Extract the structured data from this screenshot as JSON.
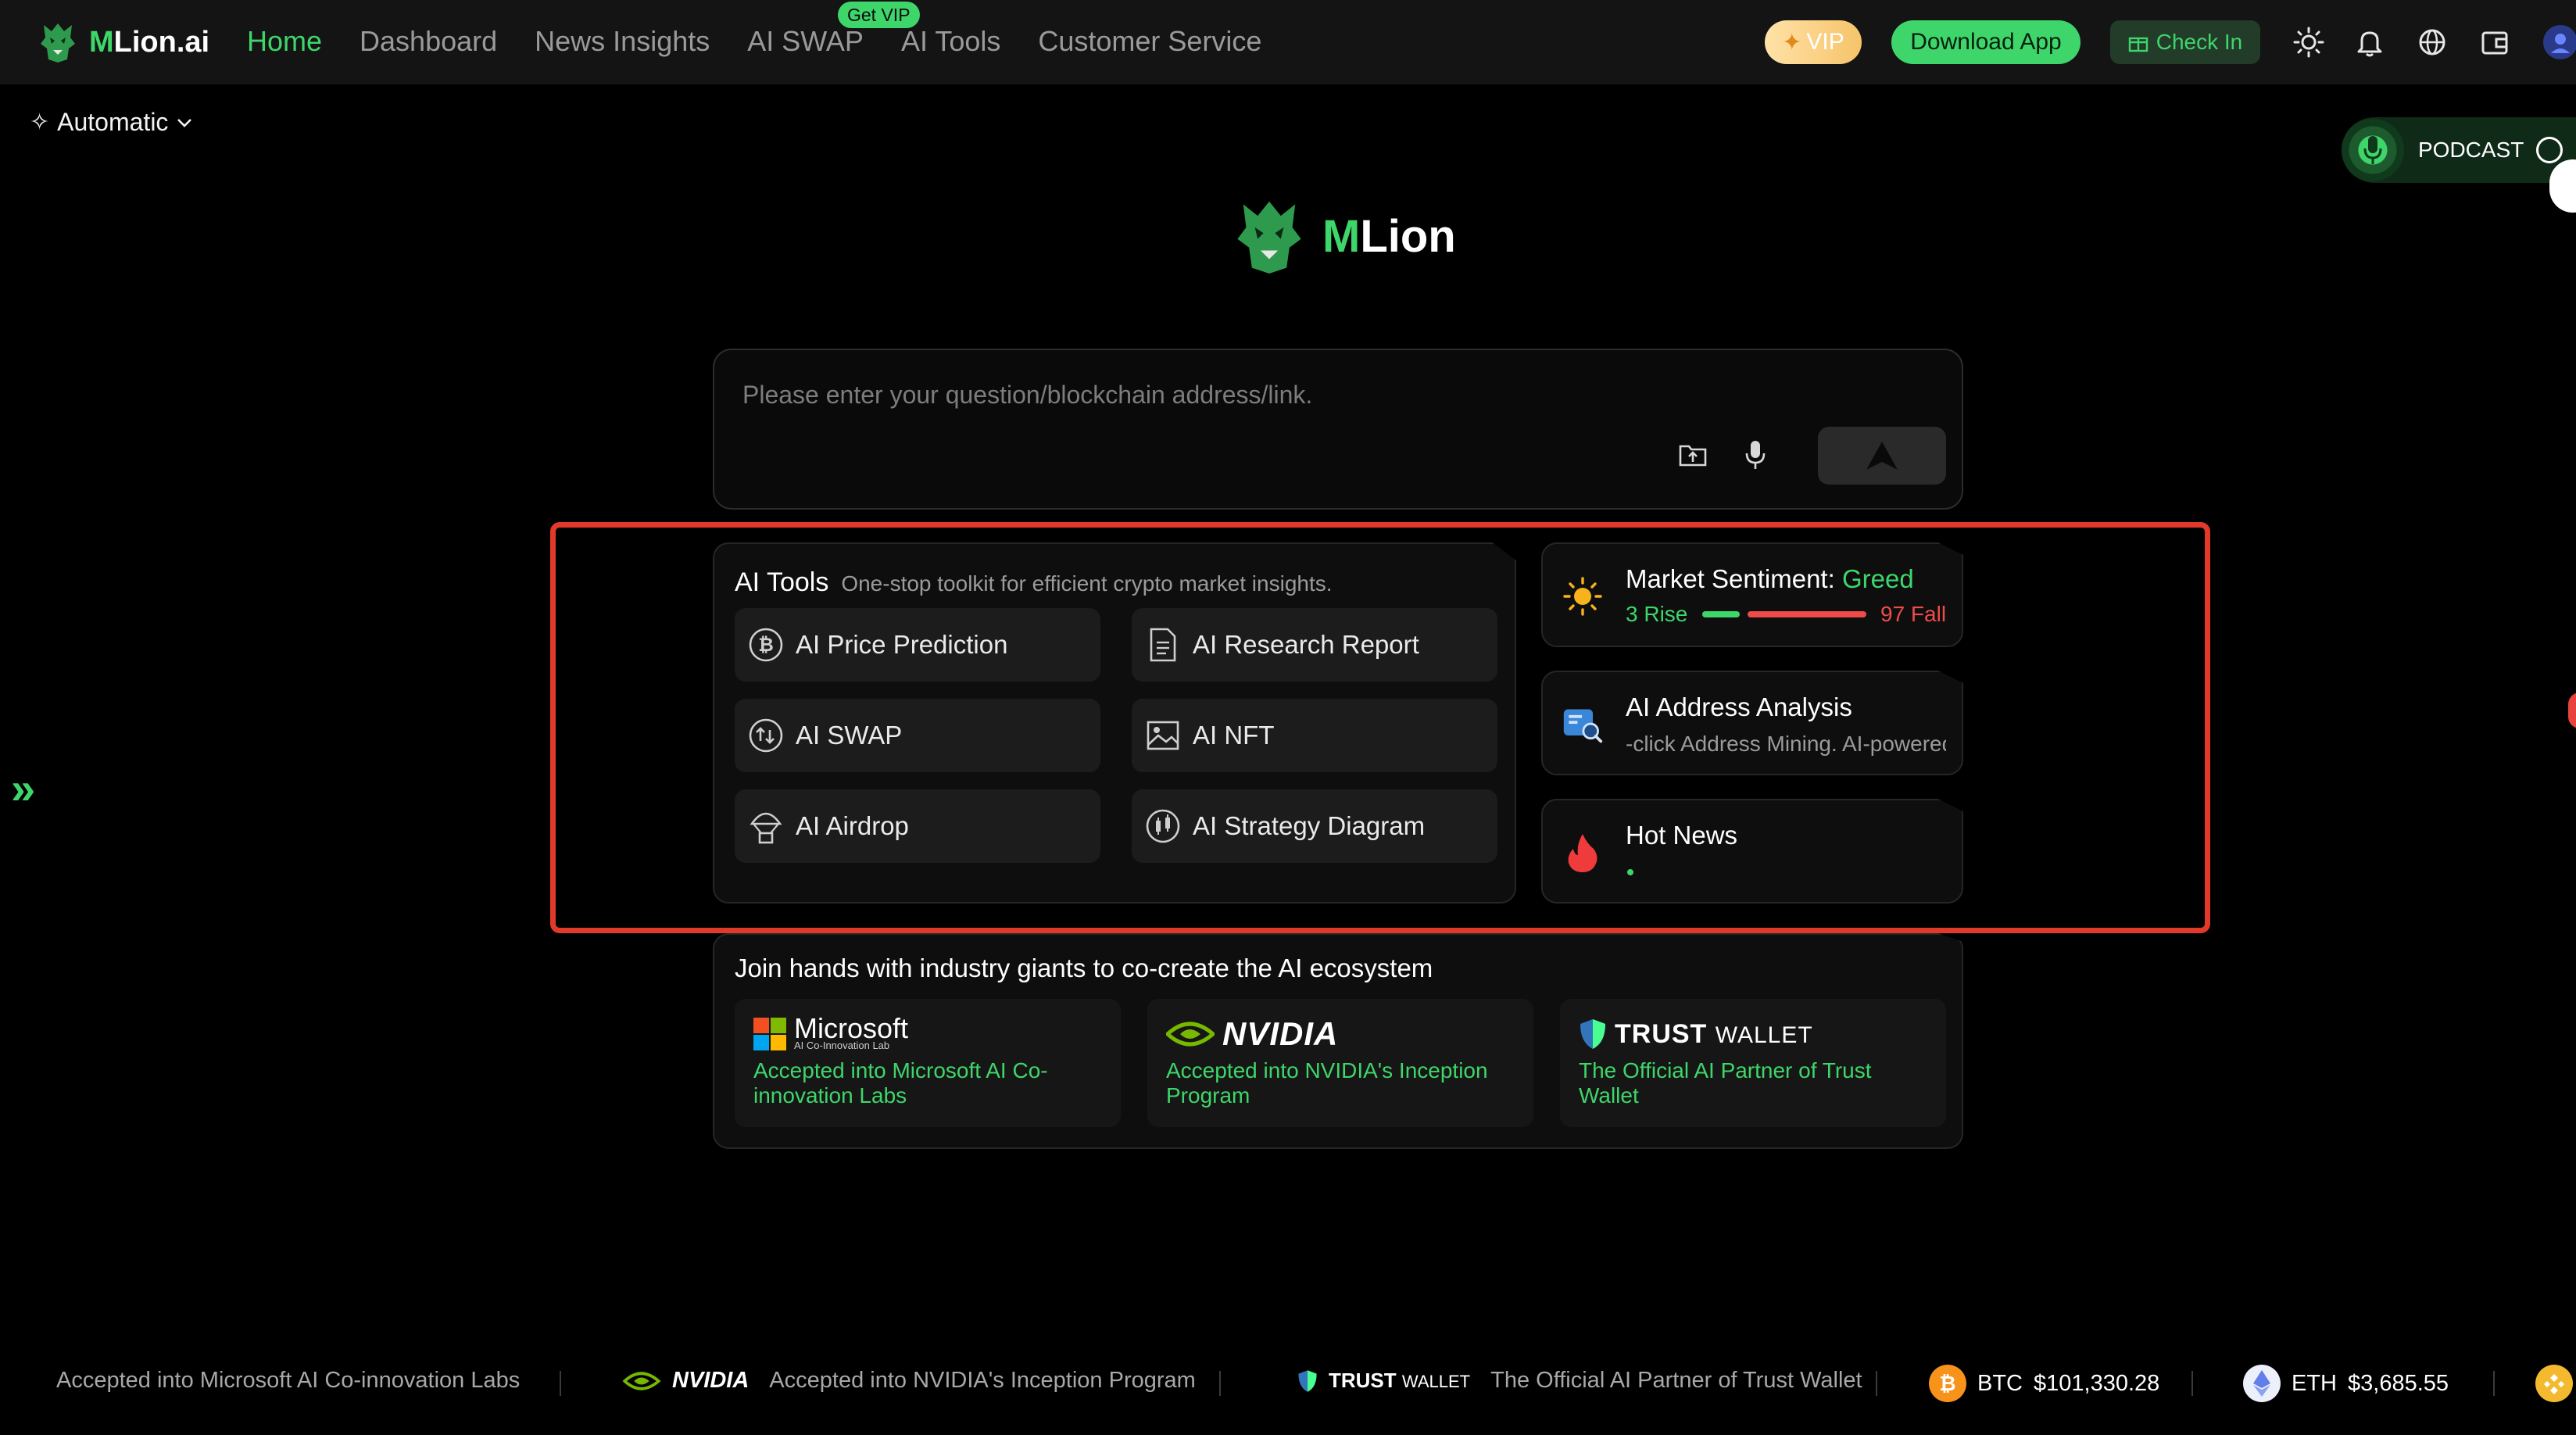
{
  "brand": {
    "name_prefix": "M",
    "name_rest": "Lion.ai",
    "hero_prefix": "M",
    "hero_rest": "Lion"
  },
  "nav": {
    "items": [
      "Home",
      "Dashboard",
      "News Insights",
      "AI SWAP",
      "AI Tools",
      "Customer Service"
    ],
    "active": "Home",
    "badge": "Get VIP"
  },
  "header_actions": {
    "vip": "VIP",
    "download": "Download App",
    "checkin": "Check In"
  },
  "mode": {
    "label": "Automatic"
  },
  "podcast": {
    "label": "PODCAST"
  },
  "search": {
    "placeholder": "Please enter your question/blockchain address/link."
  },
  "tools": {
    "title": "AI Tools",
    "subtitle": "One-stop toolkit for efficient crypto market insights.",
    "items": [
      {
        "label": "AI Price Prediction",
        "icon": "bitcoin-icon"
      },
      {
        "label": "AI Research Report",
        "icon": "document-icon"
      },
      {
        "label": "AI SWAP",
        "icon": "swap-icon"
      },
      {
        "label": "AI NFT",
        "icon": "image-icon"
      },
      {
        "label": "AI Airdrop",
        "icon": "parachute-icon"
      },
      {
        "label": "AI Strategy Diagram",
        "icon": "strategy-icon"
      }
    ]
  },
  "sentiment": {
    "title": "Market Sentiment: ",
    "value": "Greed",
    "rise_count": 3,
    "rise_label": "3 Rise",
    "fall_count": 97,
    "fall_label": "97 Fall",
    "colors": {
      "rise": "#3ed66a",
      "fall": "#ef4b4b"
    }
  },
  "address": {
    "title": "AI Address Analysis",
    "subtitle": "-click Address Mining. AI-powered"
  },
  "hotnews": {
    "title": "Hot News"
  },
  "partners": {
    "title": "Join hands with industry giants to co-create the AI ecosystem",
    "items": [
      {
        "logo": "Microsoft",
        "logo_sub": "AI Co-Innovation Lab",
        "desc": "Accepted into Microsoft AI Co-innovation Labs"
      },
      {
        "logo": "NVIDIA",
        "desc": "Accepted into NVIDIA's Inception Program"
      },
      {
        "logo_bold": "TRUST",
        "logo_light": "WALLET",
        "desc": "The Official AI Partner of Trust Wallet"
      }
    ]
  },
  "ticker": {
    "items": [
      "Accepted into Microsoft AI Co-innovation Labs",
      "Accepted into NVIDIA's Inception Program",
      "The Official AI Partner of Trust Wallet"
    ],
    "nvidia_logo": "NVIDIA",
    "trust_bold": "TRUST",
    "trust_light": "WALLET",
    "coins": [
      {
        "symbol": "BTC",
        "price": "$101,330.28"
      },
      {
        "symbol": "ETH",
        "price": "$3,685.55"
      }
    ]
  },
  "colors": {
    "accent": "#3ed66a",
    "background": "#000000",
    "nav_bg": "#141414",
    "highlight": "#e23a2a"
  }
}
